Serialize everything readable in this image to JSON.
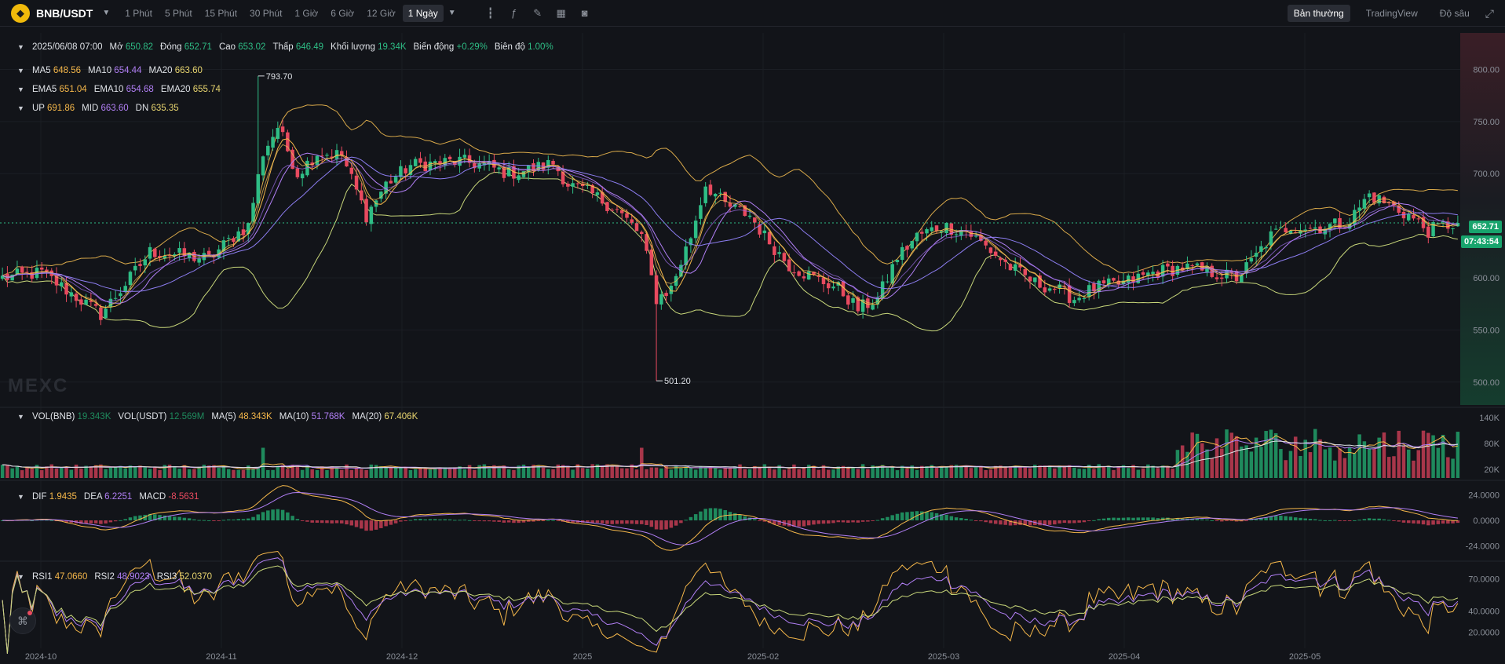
{
  "header": {
    "symbol": "BNB/USDT",
    "coin_icon": "bnb-coin-icon",
    "intervals": [
      "1 Phút",
      "5 Phút",
      "15 Phút",
      "30 Phút",
      "1 Giờ",
      "6 Giờ",
      "12 Giờ",
      "1 Ngày"
    ],
    "active_interval": "1 Ngày",
    "view_tabs": [
      "Bản thường",
      "TradingView",
      "Độ sâu"
    ],
    "active_view": "Bản thường"
  },
  "ohlc": {
    "date": "2025/06/08 07:00",
    "open_label": "Mở",
    "open": "650.82",
    "close_label": "Đóng",
    "close": "652.71",
    "high_label": "Cao",
    "high": "653.02",
    "low_label": "Thấp",
    "low": "646.49",
    "vol_label": "Khối lượng",
    "vol": "19.34K",
    "change_label": "Biến động",
    "change": "+0.29%",
    "amp_label": "Biên độ",
    "amp": "1.00%"
  },
  "ma": {
    "ma5_label": "MA5",
    "ma5": "648.56",
    "ma10_label": "MA10",
    "ma10": "654.44",
    "ma20_label": "MA20",
    "ma20": "663.60"
  },
  "ema": {
    "ema5_label": "EMA5",
    "ema5": "651.04",
    "ema10_label": "EMA10",
    "ema10": "654.68",
    "ema20_label": "EMA20",
    "ema20": "655.74"
  },
  "boll": {
    "up_label": "UP",
    "up": "691.86",
    "mid_label": "MID",
    "mid": "663.60",
    "dn_label": "DN",
    "dn": "635.35"
  },
  "vol": {
    "vol_label": "VOL(BNB)",
    "vol": "19.343K",
    "volu_label": "VOL(USDT)",
    "volu": "12.569M",
    "ma5_label": "MA(5)",
    "ma5": "48.343K",
    "ma10_label": "MA(10)",
    "ma10": "51.768K",
    "ma20_label": "MA(20)",
    "ma20": "67.406K"
  },
  "macd": {
    "dif_label": "DIF",
    "dif": "1.9435",
    "dea_label": "DEA",
    "dea": "6.2251",
    "macd_label": "MACD",
    "macd": "-8.5631"
  },
  "rsi": {
    "rsi1_label": "RSI1",
    "rsi1": "47.0660",
    "rsi2_label": "RSI2",
    "rsi2": "48.9023",
    "rsi3_label": "RSI3",
    "rsi3": "52.0370"
  },
  "price_tag": {
    "price": "652.71",
    "countdown": "07:43:54"
  },
  "watermark": "MEXC",
  "colors": {
    "up": "#2ebd85",
    "down": "#e84a5f",
    "ma5": "#f5b74a",
    "ma10": "#b17ff5",
    "ma20": "#e8d56f",
    "boll": "#d9c66a",
    "bg": "#121419"
  },
  "chart_data": {
    "type": "candlestick",
    "x_ticks": [
      "2024-10",
      "2024-11",
      "2024-12",
      "2025",
      "2025-02",
      "2025-03",
      "2025-04",
      "2025-05"
    ],
    "price_ticks": [
      800.0,
      750.0,
      700.0,
      600.0,
      550.0,
      500.0
    ],
    "price_range": [
      478,
      835
    ],
    "max_marker": "793.70",
    "min_marker": "501.20",
    "vol_ticks": [
      "140K",
      "80K",
      "20K"
    ],
    "macd_ticks": [
      "24.0000",
      "0.0000",
      "-24.0000"
    ],
    "rsi_ticks": [
      "70.0000",
      "40.0000",
      "20.0000"
    ],
    "close_anchors": [
      [
        0,
        600
      ],
      [
        8,
        605
      ],
      [
        14,
        585
      ],
      [
        20,
        565
      ],
      [
        26,
        600
      ],
      [
        30,
        625
      ],
      [
        36,
        622
      ],
      [
        42,
        618
      ],
      [
        47,
        640
      ],
      [
        50,
        650
      ],
      [
        53,
        720
      ],
      [
        56,
        745
      ],
      [
        60,
        700
      ],
      [
        64,
        720
      ],
      [
        69,
        718
      ],
      [
        74,
        660
      ],
      [
        78,
        690
      ],
      [
        83,
        708
      ],
      [
        88,
        710
      ],
      [
        93,
        712
      ],
      [
        98,
        708
      ],
      [
        103,
        700
      ],
      [
        108,
        705
      ],
      [
        112,
        710
      ],
      [
        115,
        690
      ],
      [
        120,
        680
      ],
      [
        125,
        665
      ],
      [
        130,
        640
      ],
      [
        133,
        580
      ],
      [
        136,
        590
      ],
      [
        140,
        640
      ],
      [
        143,
        690
      ],
      [
        147,
        670
      ],
      [
        152,
        660
      ],
      [
        155,
        640
      ],
      [
        160,
        612
      ],
      [
        165,
        600
      ],
      [
        170,
        590
      ],
      [
        174,
        570
      ],
      [
        178,
        580
      ],
      [
        182,
        620
      ],
      [
        186,
        640
      ],
      [
        191,
        650
      ],
      [
        196,
        645
      ],
      [
        200,
        630
      ],
      [
        205,
        610
      ],
      [
        210,
        595
      ],
      [
        214,
        590
      ],
      [
        218,
        580
      ],
      [
        222,
        590
      ],
      [
        228,
        595
      ],
      [
        234,
        605
      ],
      [
        240,
        610
      ],
      [
        246,
        605
      ],
      [
        251,
        600
      ],
      [
        254,
        615
      ],
      [
        258,
        640
      ],
      [
        262,
        650
      ],
      [
        266,
        648
      ],
      [
        270,
        650
      ],
      [
        274,
        655
      ],
      [
        278,
        680
      ],
      [
        282,
        670
      ],
      [
        286,
        660
      ],
      [
        290,
        645
      ],
      [
        293,
        650
      ],
      [
        296,
        652.71
      ]
    ],
    "ma5": "648.56",
    "ma10": "654.44",
    "ma20": "663.60",
    "last_close": 652.71,
    "rsi_last": [
      47.066,
      48.9023,
      52.037
    ],
    "macd_last": {
      "dif": 1.9435,
      "dea": 6.2251,
      "hist": -8.5631
    }
  }
}
